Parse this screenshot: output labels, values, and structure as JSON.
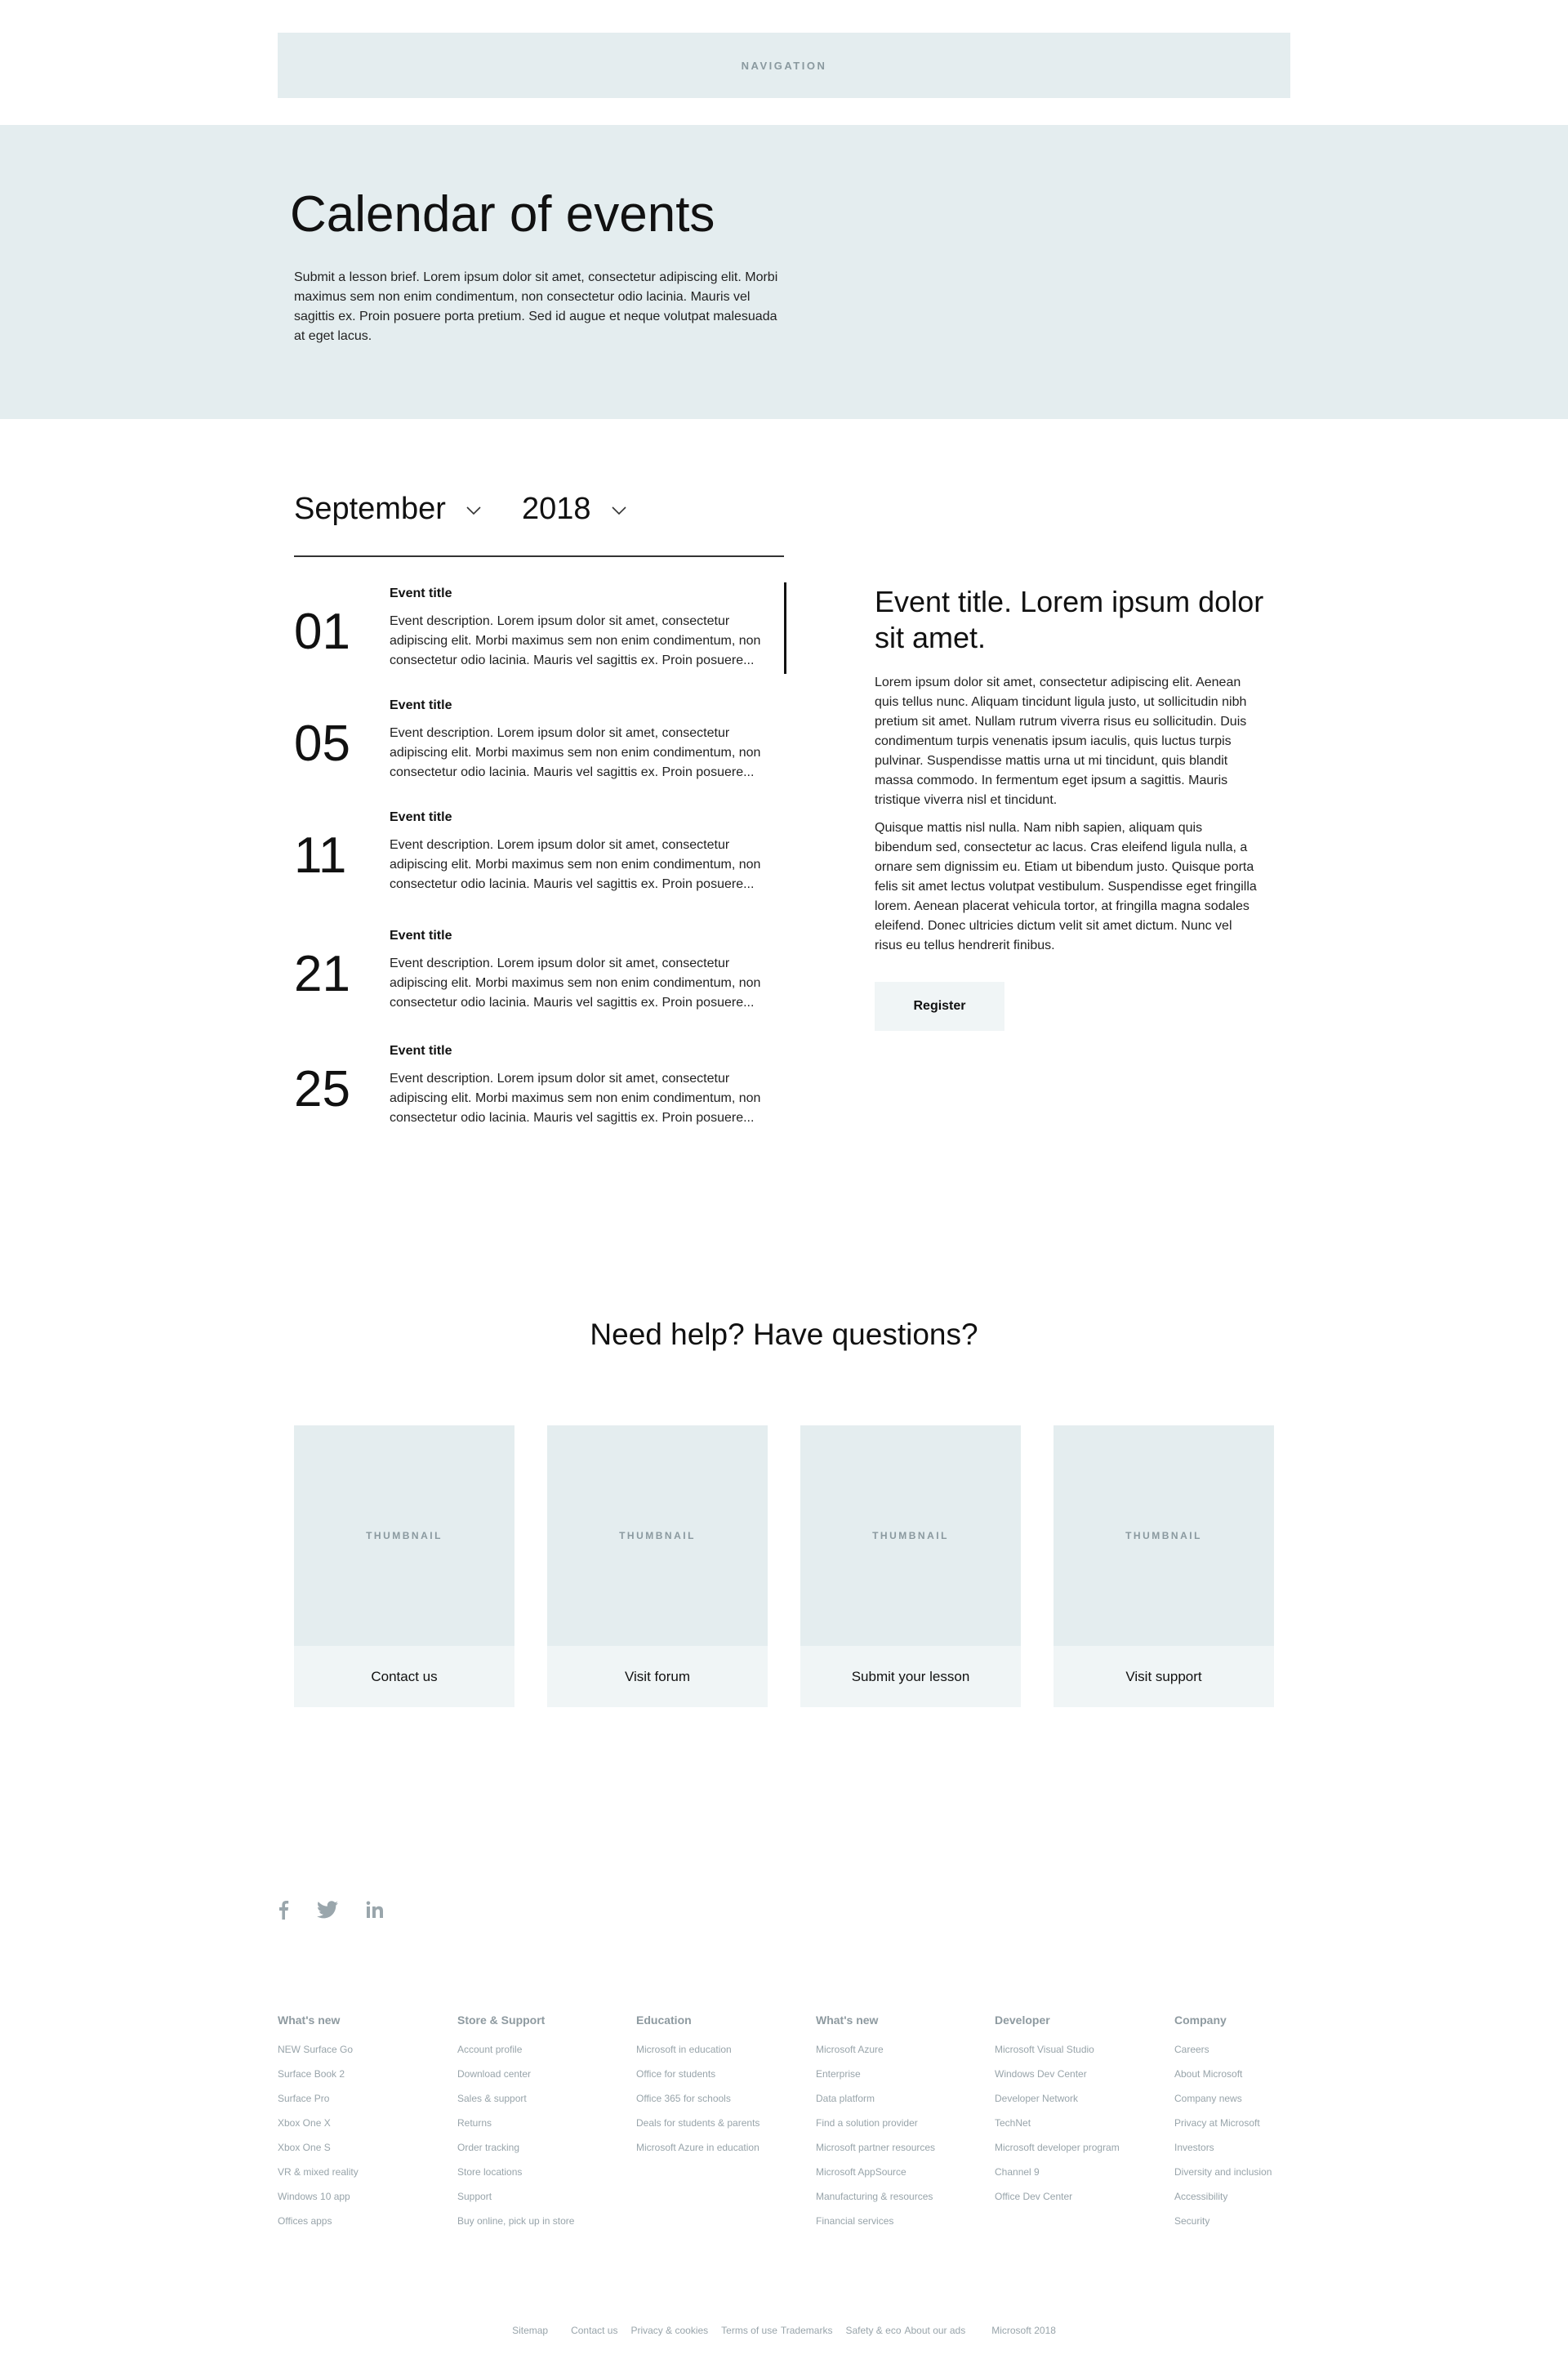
{
  "navigation": {
    "label": "NAVIGATION"
  },
  "hero": {
    "title": "Calendar of events",
    "description": "Submit a lesson brief. Lorem ipsum dolor sit amet, consectetur adipiscing elit. Morbi maximus sem non enim condimentum, non consectetur odio lacinia. Mauris vel sagittis ex. Proin posuere porta pretium. Sed id augue et neque volutpat malesuada at eget lacus."
  },
  "filters": {
    "month": "September",
    "year": "2018"
  },
  "events": [
    {
      "day": "01",
      "title": "Event title",
      "description": "Event description. Lorem ipsum dolor sit amet, consectetur adipiscing elit. Morbi maximus sem non enim condimentum, non consectetur odio lacinia. Mauris vel sagittis ex. Proin posuere..."
    },
    {
      "day": "05",
      "title": "Event title",
      "description": "Event description. Lorem ipsum dolor sit amet, consectetur adipiscing elit. Morbi maximus sem non enim condimentum, non consectetur odio lacinia. Mauris vel sagittis ex. Proin posuere..."
    },
    {
      "day": "11",
      "title": "Event title",
      "description": "Event description. Lorem ipsum dolor sit amet, consectetur adipiscing elit. Morbi maximus sem non enim condimentum, non consectetur odio lacinia. Mauris vel sagittis ex. Proin posuere..."
    },
    {
      "day": "21",
      "title": "Event title",
      "description": "Event description. Lorem ipsum dolor sit amet, consectetur adipiscing elit. Morbi maximus sem non enim condimentum, non consectetur odio lacinia. Mauris vel sagittis ex. Proin posuere..."
    },
    {
      "day": "25",
      "title": "Event title",
      "description": "Event description. Lorem ipsum dolor sit amet, consectetur adipiscing elit. Morbi maximus sem non enim condimentum, non consectetur odio lacinia. Mauris vel sagittis ex. Proin posuere..."
    }
  ],
  "detail": {
    "title": "Event title. Lorem ipsum dolor sit amet.",
    "paragraph1": "Lorem ipsum dolor sit amet, consectetur adipiscing elit. Aenean quis tellus nunc. Aliquam tincidunt ligula justo, ut sollicitudin nibh pretium sit amet. Nullam rutrum viverra risus eu sollicitudin. Duis condimentum turpis venenatis ipsum iaculis, quis luctus turpis pulvinar. Suspendisse mattis urna ut mi tincidunt, quis blandit massa commodo. In fermentum eget ipsum a sagittis. Mauris tristique viverra nisl et tincidunt.",
    "paragraph2": "Quisque mattis nisl nulla. Nam nibh sapien, aliquam quis bibendum sed, consectetur ac lacus. Cras eleifend ligula nulla, a ornare sem dignissim eu. Etiam ut bibendum justo. Quisque porta felis sit amet lectus volutpat vestibulum. Suspendisse eget fringilla lorem. Aenean placerat vehicula tortor, at fringilla magna sodales eleifend. Donec ultricies dictum velit sit amet dictum. Nunc vel risus eu tellus hendrerit finibus.",
    "register_label": "Register"
  },
  "help": {
    "title": "Need help? Have questions?",
    "cards": [
      {
        "thumb": "THUMBNAIL",
        "label": "Contact us"
      },
      {
        "thumb": "THUMBNAIL",
        "label": "Visit forum"
      },
      {
        "thumb": "THUMBNAIL",
        "label": "Submit your lesson"
      },
      {
        "thumb": "THUMBNAIL",
        "label": "Visit support"
      }
    ]
  },
  "social": {
    "icons": [
      "facebook-icon",
      "twitter-icon",
      "linkedin-icon"
    ]
  },
  "footer": {
    "columns": [
      {
        "title": "What's new",
        "links": [
          "NEW Surface Go",
          "Surface Book 2",
          "Surface Pro",
          "Xbox One X",
          "Xbox One S",
          "VR & mixed reality",
          "Windows 10 app",
          "Offices apps"
        ]
      },
      {
        "title": "Store & Support",
        "links": [
          "Account profile",
          "Download center",
          "Sales & support",
          "Returns",
          "Order tracking",
          "Store locations",
          "Support",
          "Buy online, pick up in store"
        ]
      },
      {
        "title": "Education",
        "links": [
          "Microsoft in education",
          "Office for students",
          "Office 365 for schools",
          "Deals for students & parents",
          "Microsoft Azure in education"
        ]
      },
      {
        "title": "What's new",
        "links": [
          "Microsoft Azure",
          "Enterprise",
          "Data platform",
          "Find a solution provider",
          "Microsoft partner resources",
          "Microsoft AppSource",
          "Manufacturing & resources",
          "Financial services"
        ]
      },
      {
        "title": "Developer",
        "links": [
          "Microsoft Visual Studio",
          "Windows Dev Center",
          "Developer Network",
          "TechNet",
          "Microsoft developer program",
          "Channel 9",
          "Office Dev Center"
        ]
      },
      {
        "title": "Company",
        "links": [
          "Careers",
          "About Microsoft",
          "Company news",
          "Privacy at Microsoft",
          "Investors",
          "Diversity and inclusion",
          "Accessibility",
          "Security"
        ]
      }
    ],
    "bottom": {
      "sitemap": "Sitemap",
      "contact": "Contact us",
      "privacy": "Privacy & cookies",
      "terms": "Terms of use",
      "trademarks": "Trademarks",
      "safety": "Safety & eco",
      "ads": "About our ads",
      "copyright": "Microsoft 2018"
    }
  },
  "colors": {
    "panel": "#e4edef",
    "card_footer": "#f0f5f6",
    "muted_text": "#98a4aa"
  }
}
